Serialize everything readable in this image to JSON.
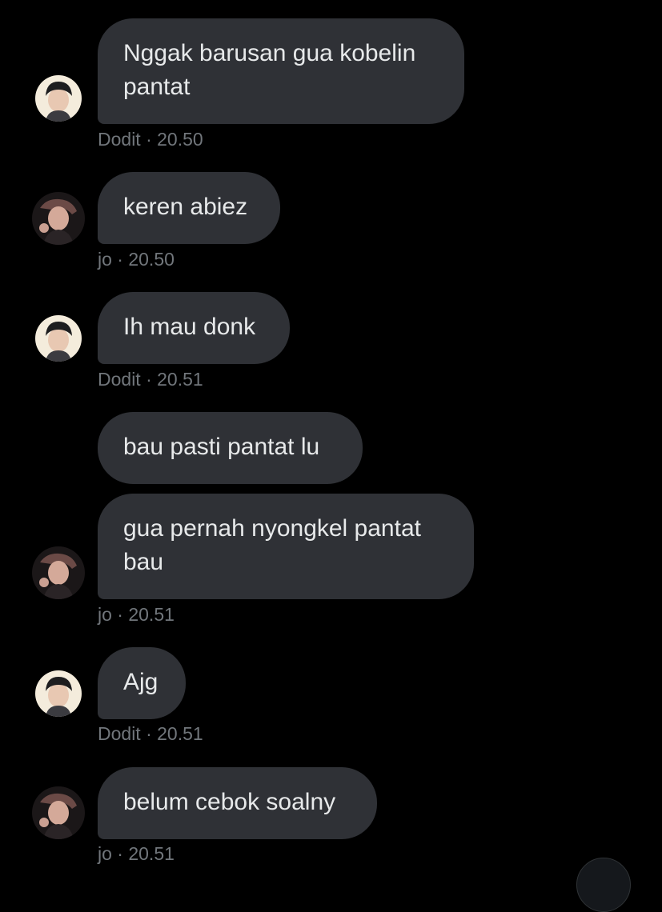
{
  "conversation": {
    "messages": [
      {
        "text": "Nggak barusan gua kobelin pantat",
        "sender": "Dodit",
        "time": "20.50"
      },
      {
        "text": "keren abiez",
        "sender": "jo",
        "time": "20.50"
      },
      {
        "text": "Ih mau donk",
        "sender": "Dodit",
        "time": "20.51"
      },
      {
        "text": "bau pasti pantat lu",
        "sender": "jo",
        "time": ""
      },
      {
        "text": "gua pernah nyongkel pantat bau",
        "sender": "jo",
        "time": "20.51"
      },
      {
        "text": "Ajg",
        "sender": "Dodit",
        "time": "20.51"
      },
      {
        "text": "belum cebok soalny",
        "sender": "jo",
        "time": "20.51"
      }
    ],
    "meta_separator": "·",
    "meta_labels": [
      "Dodit · 20.50",
      "jo · 20.50",
      "Dodit · 20.51",
      "jo · 20.51",
      "Dodit · 20.51",
      "jo · 20.51"
    ]
  },
  "colors": {
    "background": "#000000",
    "bubble": "#2f3136",
    "text": "#e7e9ea",
    "meta": "#71767b"
  },
  "icons": {
    "avatar_dodit": "avatar-dodit-icon",
    "avatar_jo": "avatar-jo-icon",
    "scroll_down": "scroll-down-icon"
  }
}
